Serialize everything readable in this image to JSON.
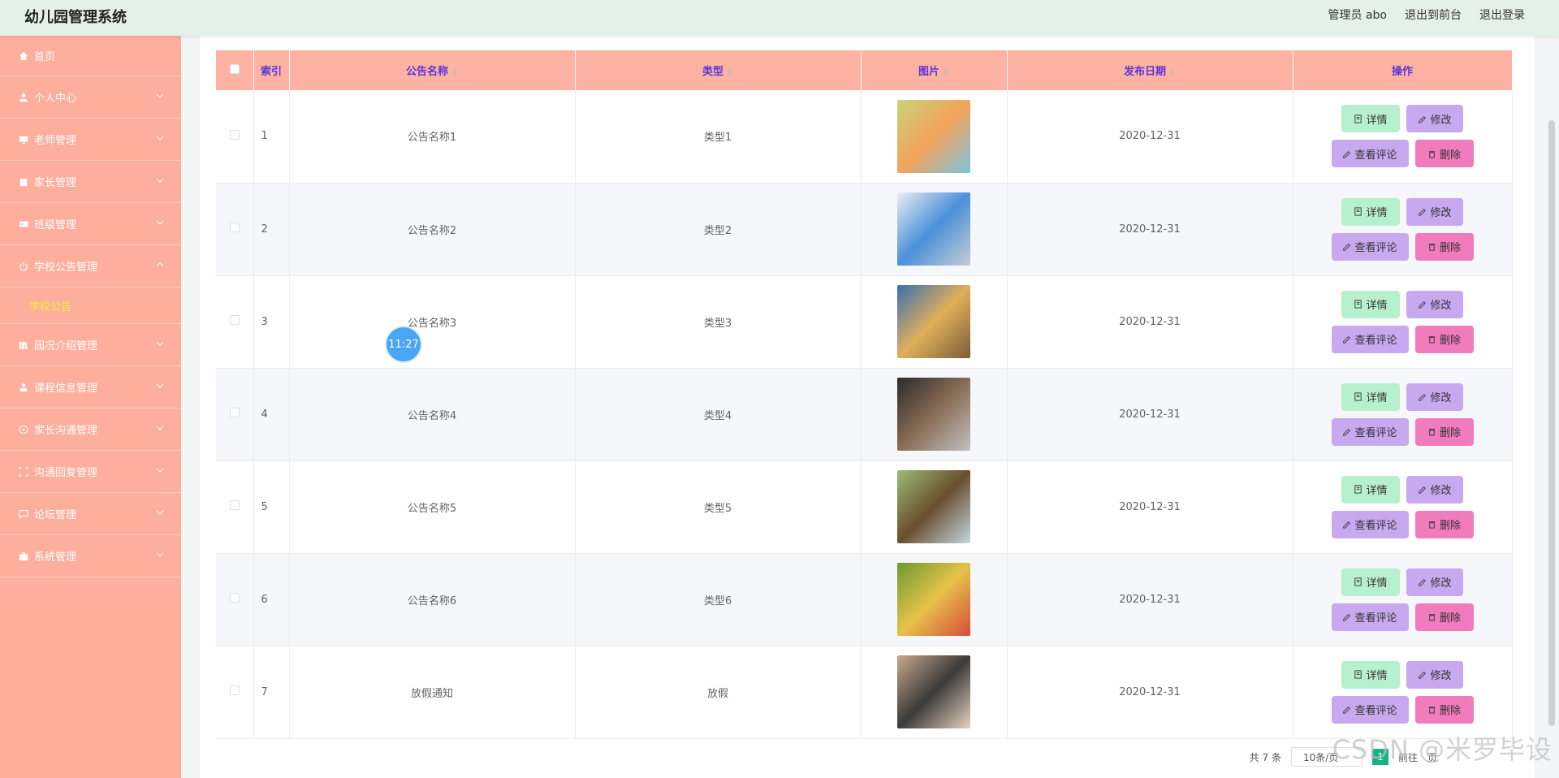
{
  "header": {
    "title": "幼儿园管理系统",
    "user": "管理员 abo",
    "to_front": "退出到前台",
    "logout": "退出登录"
  },
  "sidebar": {
    "items": [
      {
        "label": "首页",
        "icon": "home-icon"
      },
      {
        "label": "个人中心",
        "icon": "person-icon"
      },
      {
        "label": "老师管理",
        "icon": "monitor-icon"
      },
      {
        "label": "家长管理",
        "icon": "clipboard-icon"
      },
      {
        "label": "班级管理",
        "icon": "ticket-icon"
      },
      {
        "label": "学校公告管理",
        "icon": "power-icon",
        "expanded": true
      },
      {
        "label": "园况介绍管理",
        "icon": "library-icon"
      },
      {
        "label": "课程信息管理",
        "icon": "user-icon"
      },
      {
        "label": "家长沟通管理",
        "icon": "compass-icon"
      },
      {
        "label": "沟通回复管理",
        "icon": "fullscreen-icon"
      },
      {
        "label": "论坛管理",
        "icon": "chat-icon"
      },
      {
        "label": "系统管理",
        "icon": "briefcase-icon"
      }
    ],
    "active_sub": "学校公告"
  },
  "table": {
    "headers": [
      "索引",
      "公告名称",
      "类型",
      "图片",
      "发布日期",
      "操作"
    ],
    "rows": [
      {
        "index": "1",
        "name": "公告名称1",
        "type": "类型1",
        "date": "2020-12-31"
      },
      {
        "index": "2",
        "name": "公告名称2",
        "type": "类型2",
        "date": "2020-12-31"
      },
      {
        "index": "3",
        "name": "公告名称3",
        "type": "类型3",
        "date": "2020-12-31"
      },
      {
        "index": "4",
        "name": "公告名称4",
        "type": "类型4",
        "date": "2020-12-31"
      },
      {
        "index": "5",
        "name": "公告名称5",
        "type": "类型5",
        "date": "2020-12-31"
      },
      {
        "index": "6",
        "name": "公告名称6",
        "type": "类型6",
        "date": "2020-12-31"
      },
      {
        "index": "7",
        "name": "放假通知",
        "type": "放假",
        "date": "2020-12-31"
      }
    ],
    "actions": {
      "detail": "详情",
      "edit": "修改",
      "comments": "查看评论",
      "delete": "删除"
    }
  },
  "pager": {
    "total": "共 7 条",
    "page_size": "10条/页",
    "goto": "前往",
    "page_unit": "页"
  },
  "timer": "11:27",
  "watermark": "CSDN @米罗毕设",
  "colors": {
    "sidebar": "#fdae9d",
    "header": "#e3f1e8",
    "table_head": "#fdb2a3",
    "detail_btn": "#b7f0cc",
    "edit_btn": "#c8a8ef",
    "delete_btn": "#f07bbd"
  }
}
